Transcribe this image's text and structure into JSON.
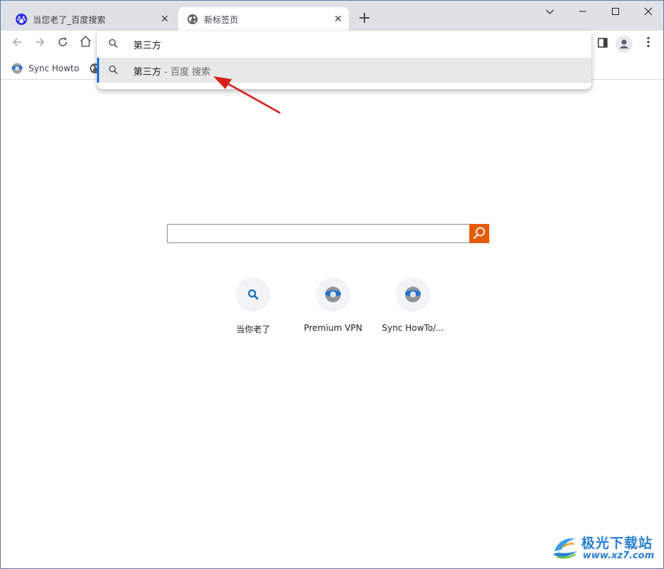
{
  "tabs": [
    {
      "title": "当您老了_百度搜索",
      "icon": "baidu-paw-icon",
      "active": false
    },
    {
      "title": "新标签页",
      "icon": "globe-icon",
      "active": true
    }
  ],
  "window": {
    "close_glyph": "✕",
    "new_tab_glyph": "+"
  },
  "bookmarks": [
    {
      "label": "Sync Howto",
      "icon": "sphere-icon"
    },
    {
      "label": "",
      "icon": "globe-icon"
    }
  ],
  "omnibox": {
    "input_value": "第三方",
    "suggestion_query": "第三方",
    "suggestion_separator": " - ",
    "suggestion_engine": "百度 搜索"
  },
  "search": {
    "value": ""
  },
  "shortcuts": [
    {
      "label": "当你老了",
      "icon": "search-icon"
    },
    {
      "label": "Premium VPN",
      "icon": "sphere-icon"
    },
    {
      "label": "Sync HowTo/...",
      "icon": "sphere-icon"
    }
  ],
  "watermark": {
    "name": "极光下载站",
    "url": "www.xz7.com"
  },
  "colors": {
    "accent": "#1a73e8",
    "search_button": "#e45c07",
    "annotation_arrow": "#d6201b",
    "watermark": "#2a7fd0"
  }
}
